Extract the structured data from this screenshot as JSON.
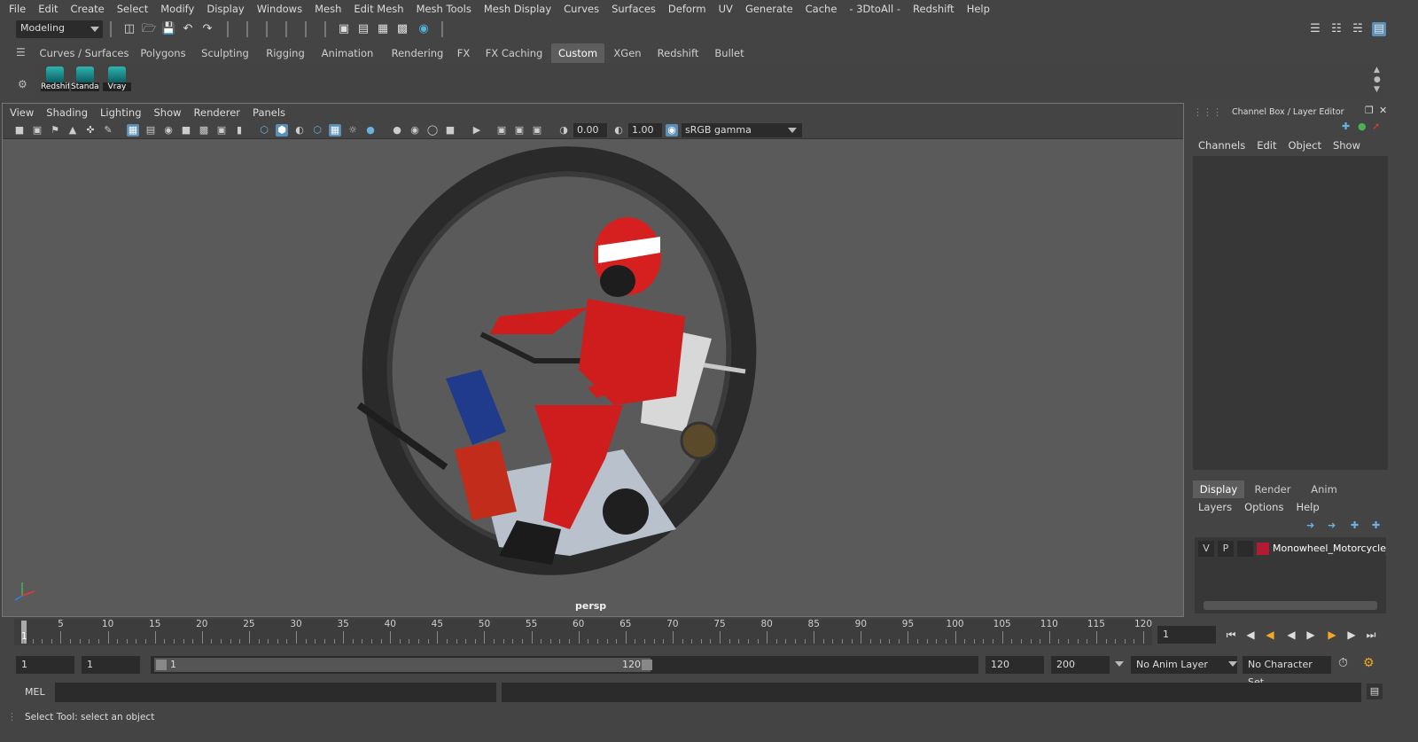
{
  "menubar": [
    "File",
    "Edit",
    "Create",
    "Select",
    "Modify",
    "Display",
    "Windows",
    "Mesh",
    "Edit Mesh",
    "Mesh Tools",
    "Mesh Display",
    "Curves",
    "Surfaces",
    "Deform",
    "UV",
    "Generate",
    "Cache",
    "- 3DtoAll -",
    "Redshift",
    "Help"
  ],
  "statusline": {
    "mode": "Modeling"
  },
  "shelf": {
    "tabs": [
      "Curves / Surfaces",
      "Polygons",
      "Sculpting",
      "Rigging",
      "Animation",
      "Rendering",
      "FX",
      "FX Caching",
      "Custom",
      "XGen",
      "Redshift",
      "Bullet"
    ],
    "active_tab": "Custom",
    "buttons": [
      "Redshif",
      "Standar",
      "Vray"
    ]
  },
  "viewport": {
    "menu": [
      "View",
      "Shading",
      "Lighting",
      "Show",
      "Renderer",
      "Panels"
    ],
    "exposure": "0.00",
    "gamma": "1.00",
    "color_space": "sRGB gamma",
    "camera": "persp"
  },
  "channelbox": {
    "title": "Channel Box / Layer Editor",
    "menu": [
      "Channels",
      "Edit",
      "Object",
      "Show"
    ],
    "layer_tabs": [
      "Display",
      "Render",
      "Anim"
    ],
    "active_layer_tab": "Display",
    "layer_menu": [
      "Layers",
      "Options",
      "Help"
    ],
    "layers": [
      {
        "v": "V",
        "p": "P",
        "name": "Monowheel_Motorcycle_",
        "color": "#b31b34"
      }
    ]
  },
  "timeline": {
    "ticks": [
      "5",
      "10",
      "15",
      "20",
      "25",
      "30",
      "35",
      "40",
      "45",
      "50",
      "55",
      "60",
      "65",
      "70",
      "75",
      "80",
      "85",
      "90",
      "95",
      "100",
      "105",
      "110",
      "115",
      "120"
    ],
    "start_label": "1",
    "current_frame": "1"
  },
  "range": {
    "start": "1",
    "playback_start": "1",
    "slider_start": "1",
    "slider_end": "120",
    "playback_end": "120",
    "end": "200",
    "anim_layer": "No Anim Layer",
    "character_set": "No Character Set"
  },
  "cmdline": {
    "label": "MEL"
  },
  "helpline": {
    "text": "Select Tool: select an object"
  }
}
